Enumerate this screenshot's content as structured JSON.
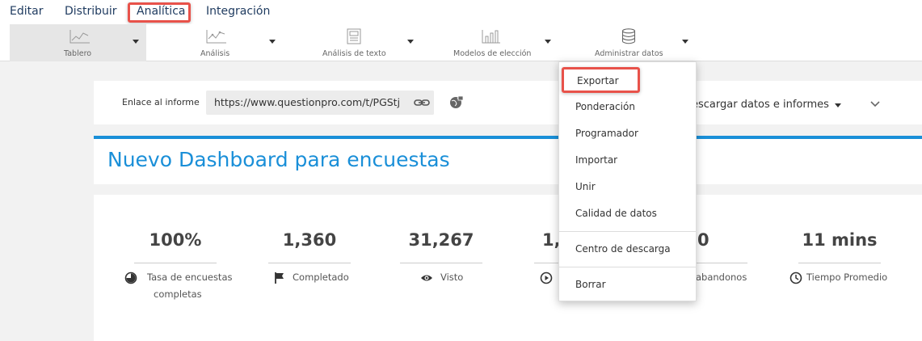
{
  "top_menu": {
    "items": [
      "Editar",
      "Distribuir",
      "Analítica",
      "Integración"
    ]
  },
  "toolbar": {
    "items": [
      {
        "label": "Tablero",
        "icon": "line-chart-icon"
      },
      {
        "label": "Análisis",
        "icon": "trend-chart-icon"
      },
      {
        "label": "Análisis de texto",
        "icon": "document-icon"
      },
      {
        "label": "Modelos de elección",
        "icon": "bar-chart-icon"
      },
      {
        "label": "Administrar datos",
        "icon": "database-icon"
      }
    ]
  },
  "report_link": {
    "label": "Enlace al informe",
    "url": "https://www.questionpro.com/t/PGStj",
    "download_label": "escargar datos e informes"
  },
  "dashboard": {
    "title": "Nuevo Dashboard para encuestas"
  },
  "stats": [
    {
      "value": "100%",
      "label": "Tasa de encuestas",
      "label2": "completas",
      "icon": "pie-icon"
    },
    {
      "value": "1,360",
      "label": "Completado",
      "icon": "flag-icon"
    },
    {
      "value": "31,267",
      "label": "Visto",
      "icon": "eye-icon"
    },
    {
      "value": "1,",
      "label": "",
      "icon": "play-icon"
    },
    {
      "value": "0",
      "label": "abandonos",
      "icon": ""
    },
    {
      "value": "11 mins",
      "label": "Tiempo Promedio",
      "icon": "clock-icon"
    }
  ],
  "dropdown": {
    "items": [
      "Exportar",
      "Ponderación",
      "Programador",
      "Importar",
      "Unir",
      "Calidad de datos",
      "Centro de descarga",
      "Borrar"
    ]
  },
  "colors": {
    "accent": "#1a8fd8",
    "highlight": "#e8524a",
    "nav_text": "#1e3a5f"
  }
}
